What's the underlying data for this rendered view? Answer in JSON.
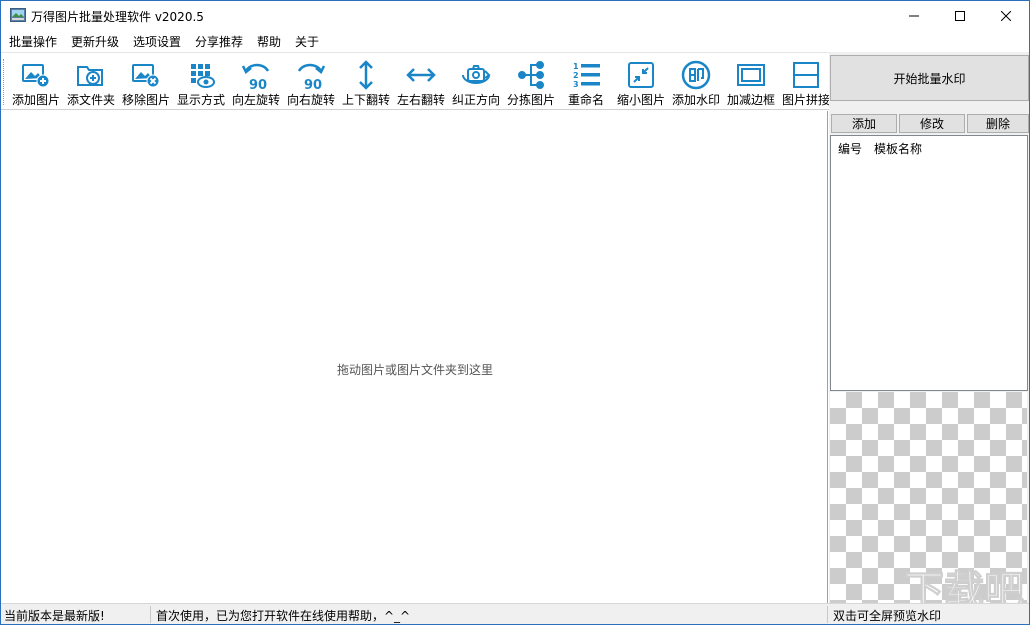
{
  "window": {
    "title": "万得图片批量处理软件 v2020.5"
  },
  "menu": [
    "批量操作",
    "更新升级",
    "选项设置",
    "分享推荐",
    "帮助",
    "关于"
  ],
  "toolbar": {
    "accent_color": "#1a86c8",
    "tools": [
      {
        "label": "添加图片",
        "icon": "add-image-icon"
      },
      {
        "label": "添文件夹",
        "icon": "add-folder-icon"
      },
      {
        "label": "移除图片",
        "icon": "remove-image-icon"
      },
      {
        "label": "显示方式",
        "icon": "display-mode-icon"
      },
      {
        "label": "向左旋转",
        "icon": "rotate-left-icon"
      },
      {
        "label": "向右旋转",
        "icon": "rotate-right-icon"
      },
      {
        "label": "上下翻转",
        "icon": "flip-vertical-icon"
      },
      {
        "label": "左右翻转",
        "icon": "flip-horizontal-icon"
      },
      {
        "label": "纠正方向",
        "icon": "correct-orientation-icon"
      },
      {
        "label": "分拣图片",
        "icon": "sort-images-icon"
      },
      {
        "label": "重命名",
        "icon": "rename-icon"
      },
      {
        "label": "缩小图片",
        "icon": "shrink-image-icon"
      },
      {
        "label": "添加水印",
        "icon": "add-watermark-icon"
      },
      {
        "label": "加减边框",
        "icon": "border-icon"
      },
      {
        "label": "图片拼接",
        "icon": "stitch-images-icon"
      }
    ],
    "rotate_badge": "90"
  },
  "main": {
    "drop_hint": "拖动图片或图片文件夹到这里"
  },
  "side": {
    "start_button": "开始批量水印",
    "add_button": "添加",
    "edit_button": "修改",
    "delete_button": "删除",
    "columns": [
      "编号",
      "模板名称"
    ],
    "watermark_text": "下载吧"
  },
  "status": {
    "version": "当前版本是最新版!",
    "message": "首次使用，已为您打开软件在线使用帮助，^_^",
    "preview_hint": "双击可全屏预览水印"
  }
}
